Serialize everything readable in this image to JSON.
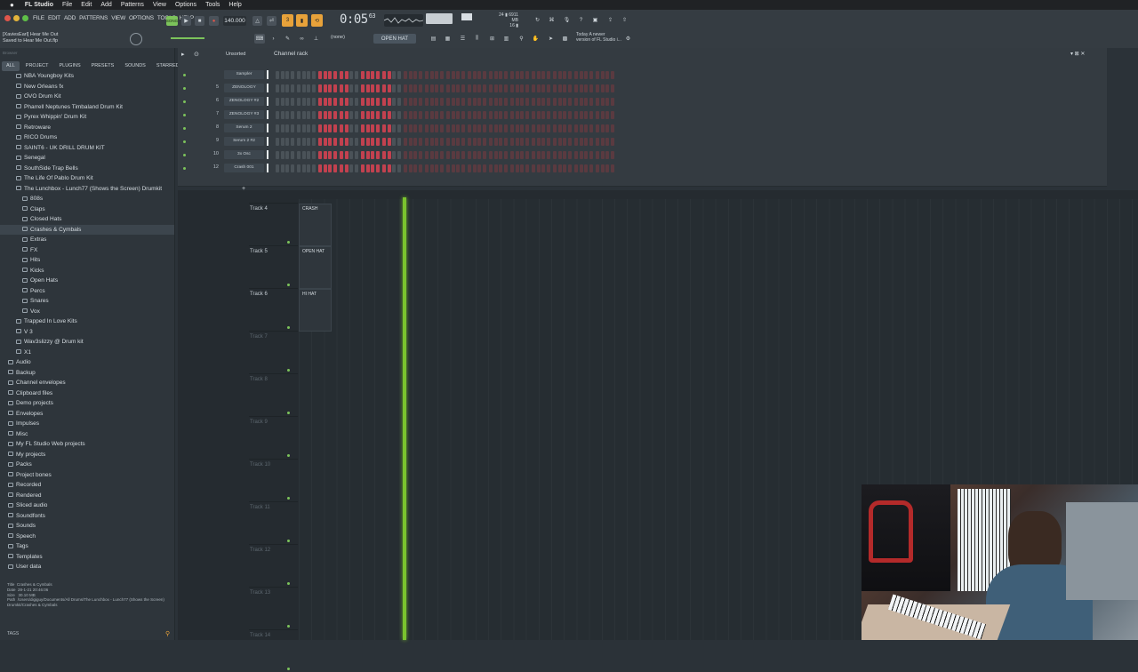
{
  "mac_menu": {
    "app": "FL Studio",
    "items": [
      "File",
      "Edit",
      "Add",
      "Patterns",
      "View",
      "Options",
      "Tools",
      "Help"
    ]
  },
  "fl_menu": [
    "FILE",
    "EDIT",
    "ADD",
    "PATTERNS",
    "VIEW",
    "OPTIONS",
    "TOOLS",
    "HELP"
  ],
  "transport": {
    "mode": "SONG",
    "tempo": "140.000",
    "time": "0:05",
    "time_ms": "63",
    "cpu": "24",
    "ram": "6911 MB",
    "poly": "16"
  },
  "project": {
    "line1": "[XaviesEarl] Hear Me Out",
    "line2": "Saved to Hear Me Out.flp"
  },
  "snap": "(none)",
  "pattern": "OPEN HAT",
  "news": {
    "line1": "Today  A newer",
    "line2": "version of FL Studio i..."
  },
  "browser": {
    "search_placeholder": "Browser",
    "tabs": [
      "ALL",
      "PROJECT",
      "PLUGINS",
      "PRESETS",
      "SOUNDS",
      "STARRED"
    ],
    "items": [
      {
        "label": "NBA Youngboy Kits",
        "indent": 2
      },
      {
        "label": "New Orleans fx",
        "indent": 2
      },
      {
        "label": "OVO Drum Kit",
        "indent": 2
      },
      {
        "label": "Pharrell Neptunes Timbaland Drum Kit",
        "indent": 2
      },
      {
        "label": "Pyrex Whippin' Drum Kit",
        "indent": 2
      },
      {
        "label": "Retroware",
        "indent": 2
      },
      {
        "label": "RICO Drums",
        "indent": 2
      },
      {
        "label": "SAINT6 - UK DRILL DRUM KIT",
        "indent": 2
      },
      {
        "label": "Senegal",
        "indent": 2
      },
      {
        "label": "SouthSide Trap Bells",
        "indent": 2
      },
      {
        "label": "The Life Of Pablo Drum Kit",
        "indent": 2
      },
      {
        "label": "The Lunchbox - Lunch77 (Shows the Screen) Drumkit",
        "indent": 2
      },
      {
        "label": "808s",
        "indent": 3
      },
      {
        "label": "Claps",
        "indent": 3
      },
      {
        "label": "Closed Hats",
        "indent": 3
      },
      {
        "label": "Crashes & Cymbals",
        "indent": 3,
        "selected": true
      },
      {
        "label": "Extras",
        "indent": 3
      },
      {
        "label": "FX",
        "indent": 3
      },
      {
        "label": "Hits",
        "indent": 3
      },
      {
        "label": "Kicks",
        "indent": 3
      },
      {
        "label": "Open Hats",
        "indent": 3
      },
      {
        "label": "Percs",
        "indent": 3
      },
      {
        "label": "Snares",
        "indent": 3
      },
      {
        "label": "Vox",
        "indent": 3
      },
      {
        "label": "Trapped In Love Kits",
        "indent": 2
      },
      {
        "label": "V 3",
        "indent": 2
      },
      {
        "label": "Wav3slizzy @ Drum kit",
        "indent": 2
      },
      {
        "label": "X1",
        "indent": 2
      },
      {
        "label": "Audio",
        "indent": 1
      },
      {
        "label": "Backup",
        "indent": 1
      },
      {
        "label": "Channel envelopes",
        "indent": 1
      },
      {
        "label": "Clipboard files",
        "indent": 1
      },
      {
        "label": "Demo projects",
        "indent": 1
      },
      {
        "label": "Envelopes",
        "indent": 1
      },
      {
        "label": "Impulses",
        "indent": 1
      },
      {
        "label": "Misc",
        "indent": 1
      },
      {
        "label": "My FL Studio Web projects",
        "indent": 1
      },
      {
        "label": "My projects",
        "indent": 1
      },
      {
        "label": "Packs",
        "indent": 1
      },
      {
        "label": "Project bones",
        "indent": 1
      },
      {
        "label": "Recorded",
        "indent": 1
      },
      {
        "label": "Rendered",
        "indent": 1
      },
      {
        "label": "Sliced audio",
        "indent": 1
      },
      {
        "label": "Soundfonts",
        "indent": 1
      },
      {
        "label": "Sounds",
        "indent": 1
      },
      {
        "label": "Speech",
        "indent": 1
      },
      {
        "label": "Tags",
        "indent": 1
      },
      {
        "label": "Templates",
        "indent": 1
      },
      {
        "label": "User data",
        "indent": 1
      }
    ],
    "info": {
      "title_label": "Title",
      "title": "Crashes & Cymbals",
      "date_label": "Date",
      "date": "28-1-21 20:46:06",
      "size_label": "Size",
      "size": "30.10 MB",
      "path_label": "Path",
      "path": "/Users/digiguy/Documents/All Drums/The Lunchbox - Lunch77 (Shows the Screen) Drumkit/Crashes & Cymbals"
    },
    "tags_label": "TAGS"
  },
  "channel_rack": {
    "filter": "Unsorted",
    "title": "Channel rack",
    "channels": [
      {
        "num": "",
        "name": "Sampler"
      },
      {
        "num": "5",
        "name": "ZENOLOGY"
      },
      {
        "num": "6",
        "name": "ZENOLOGY #2"
      },
      {
        "num": "7",
        "name": "ZENOLOGY #3"
      },
      {
        "num": "8",
        "name": "Serum 2"
      },
      {
        "num": "9",
        "name": "Serum 2 #2"
      },
      {
        "num": "10",
        "name": "3x Osc"
      },
      {
        "num": "12",
        "name": "Crash 001"
      }
    ]
  },
  "playlist": {
    "tracks": [
      {
        "label": "Track 4",
        "clip": "CRASH",
        "dim": false
      },
      {
        "label": "Track 5",
        "clip": "OPEN HAT",
        "dim": false
      },
      {
        "label": "Track 6",
        "clip": "HI HAT",
        "dim": false
      },
      {
        "label": "Track 7",
        "clip": "",
        "dim": true
      },
      {
        "label": "Track 8",
        "clip": "",
        "dim": true
      },
      {
        "label": "Track 9",
        "clip": "",
        "dim": true
      },
      {
        "label": "Track 10",
        "clip": "",
        "dim": true
      },
      {
        "label": "Track 11",
        "clip": "",
        "dim": true
      },
      {
        "label": "Track 12",
        "clip": "",
        "dim": true
      },
      {
        "label": "Track 13",
        "clip": "",
        "dim": true
      },
      {
        "label": "Track 14",
        "clip": "",
        "dim": true
      }
    ]
  },
  "colors": {
    "accent_green": "#7ac32e",
    "step_red": "#c2414f",
    "step_dim": "#5a3a40",
    "toolbar_orange": "#e8a23a"
  }
}
